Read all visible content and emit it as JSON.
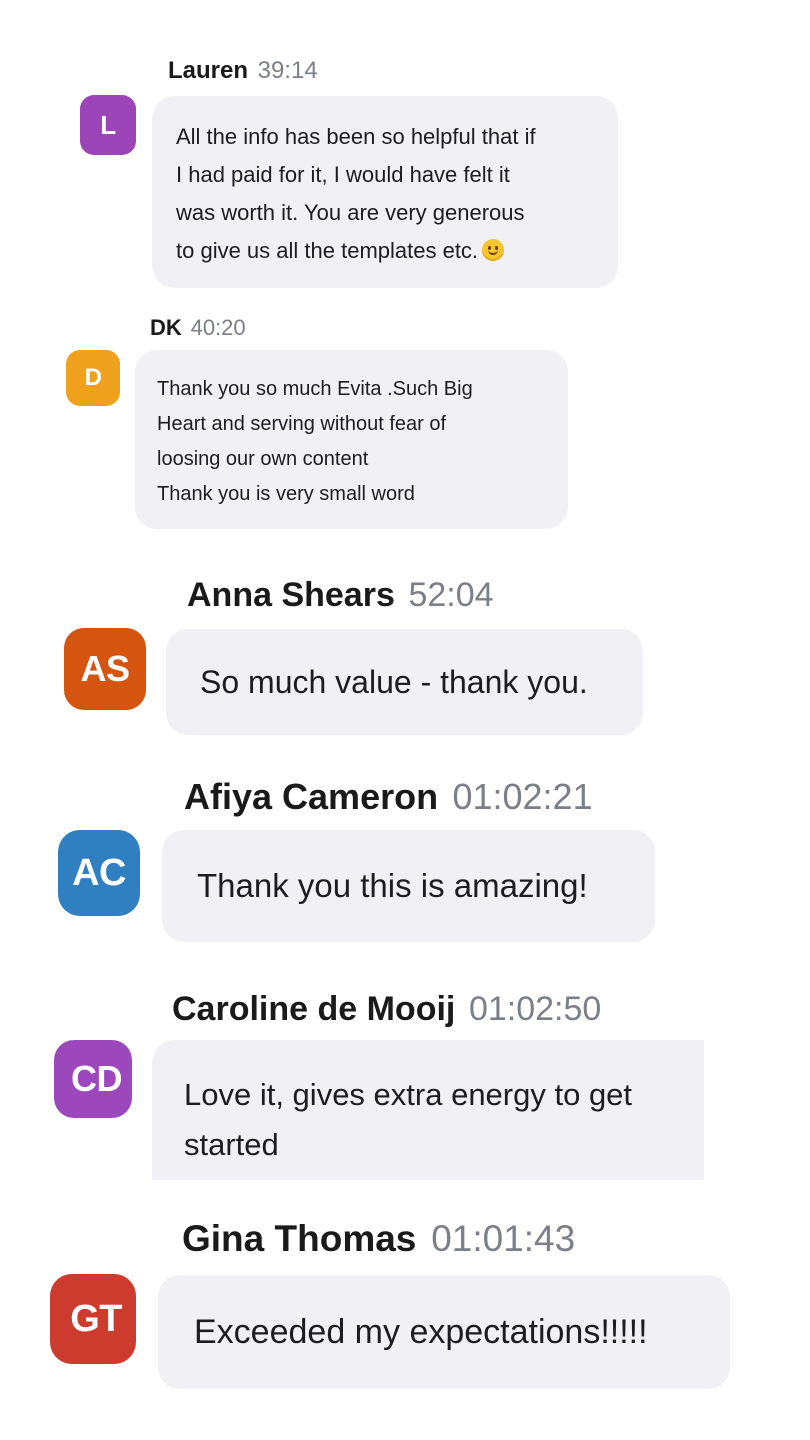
{
  "messages": [
    {
      "name": "Lauren",
      "time": "39:14",
      "initials": "L",
      "avatar_color": "#9b45b8",
      "text": "All the info has been so helpful that if\nI had paid for it, I would have felt it\nwas worth it. You are very generous\nto give us all the templates etc.",
      "emoji": "slightly-smiling-face-icon"
    },
    {
      "name": "DK",
      "time": "40:20",
      "initials": "D",
      "avatar_color": "#f0a11d",
      "text": "Thank you so much Evita .Such Big\nHeart and serving without fear of\nloosing our own content\nThank you is very small word"
    },
    {
      "name": "Anna Shears",
      "time": "52:04",
      "initials": "AS",
      "avatar_color": "#d45410",
      "text": "So much value - thank you."
    },
    {
      "name": "Afiya Cameron",
      "time": "01:02:21",
      "initials": "AC",
      "avatar_color": "#2f7fc1",
      "text": "Thank you this is amazing!"
    },
    {
      "name": "Caroline de Mooij",
      "time": "01:02:50",
      "initials": "CD",
      "avatar_color": "#9c48bc",
      "text": "Love it, gives extra energy to get\nstarted"
    },
    {
      "name": "Gina Thomas",
      "time": "01:01:43",
      "initials": "GT",
      "avatar_color": "#cc3b2e",
      "text": "Exceeded my expectations!!!!!"
    }
  ],
  "colors": {
    "bubble_bg": "#f1f1f5",
    "timestamp": "#7b7f87",
    "name": "#1a1a1a"
  }
}
